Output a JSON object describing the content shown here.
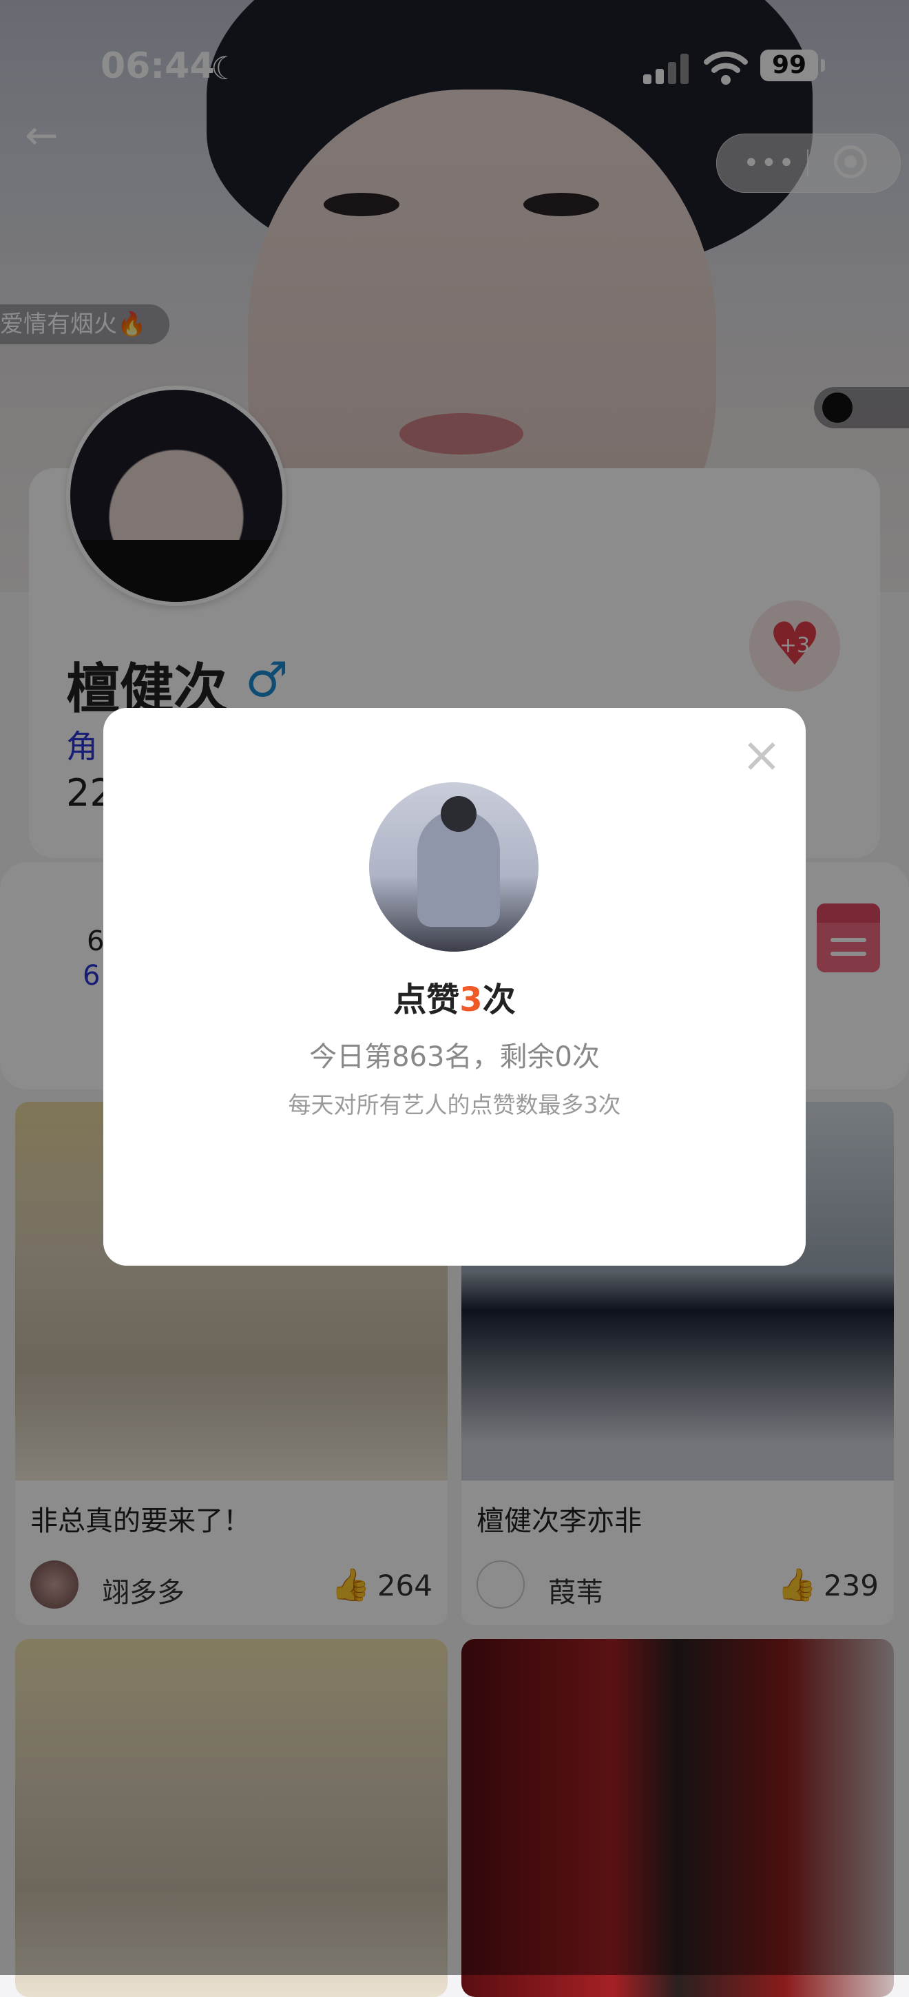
{
  "status_bar": {
    "time": "06:44",
    "battery": "99"
  },
  "hero": {
    "danmu": "爱情有烟火🔥"
  },
  "profile": {
    "name": "檀健次",
    "gender_symbol": "♂",
    "role_partial": "角",
    "age_partial": "22",
    "like_plus": "+3"
  },
  "stats": {
    "line1": "6",
    "line2": "6"
  },
  "feed": [
    {
      "title": "非总真的要来了！",
      "author": "翊多多",
      "likes": "264"
    },
    {
      "title": "檀健次李亦非",
      "author": "葭苇",
      "likes": "239"
    }
  ],
  "modal": {
    "title_prefix": "点赞",
    "title_count": "3",
    "title_suffix": "次",
    "subtitle": "今日第863名，剩余0次",
    "hint": "每天对所有艺人的点赞数最多3次"
  },
  "colors": {
    "accent_orange": "#f05a28",
    "role_blue": "#2a34d6",
    "heart_red": "#e23c4a"
  }
}
